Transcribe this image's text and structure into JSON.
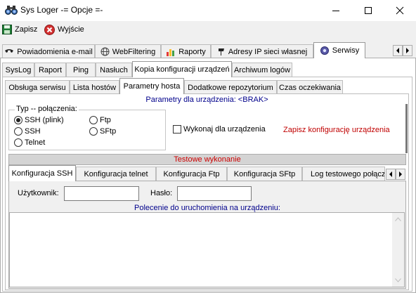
{
  "window": {
    "title": "Sys Loger -= Opcje =-"
  },
  "toolbar": {
    "save_label": "Zapisz",
    "exit_label": "Wyjście"
  },
  "main_tabs": [
    {
      "label": "Powiadomienia e-mail",
      "icon": "phone-icon"
    },
    {
      "label": "WebFiltering",
      "icon": "globe-icon"
    },
    {
      "label": "Raporty",
      "icon": "chart-icon"
    },
    {
      "label": "Adresy IP sieci własnej",
      "icon": "pin-icon"
    },
    {
      "label": "Serwisy",
      "icon": "gear-icon"
    }
  ],
  "service_tabs": [
    "SysLog",
    "Raport",
    "Ping",
    "Nasłuch",
    "Kopia konfiguracji urządzeń",
    "Archiwum logów"
  ],
  "config_tabs": [
    "Obsługa serwisu",
    "Lista hostów",
    "Parametry hosta",
    "Dodatkowe repozytorium",
    "Czas oczekiwania"
  ],
  "host_params": {
    "header": "Parametry dla urządzenia: <BRAK>",
    "connection_group_title": "Typ -- połączenia:",
    "connection_types": [
      "SSH (plink)",
      "Ftp",
      "SSH",
      "SFtp",
      "Telnet"
    ],
    "selected_connection": "SSH (plink)",
    "execute_label": "Wykonaj dla urządzenia",
    "execute_checked": false,
    "save_config_label": "Zapisz konfigurację urządzenia",
    "test_run_label": "Testowe wykonanie"
  },
  "test_tabs": [
    "Konfiguracja SSH",
    "Konfiguracja telnet",
    "Konfiguracja Ftp",
    "Konfiguracja SFtp",
    "Log testowego połącz"
  ],
  "ssh_config": {
    "user_label": "Użytkownik:",
    "user_value": "",
    "password_label": "Hasło:",
    "password_value": "",
    "command_label": "Polecenie do uruchomienia na urządzeniu:",
    "command_value": ""
  },
  "colors": {
    "link_blue": "#00008b",
    "action_red": "#c00000",
    "test_red": "#cc0000"
  }
}
